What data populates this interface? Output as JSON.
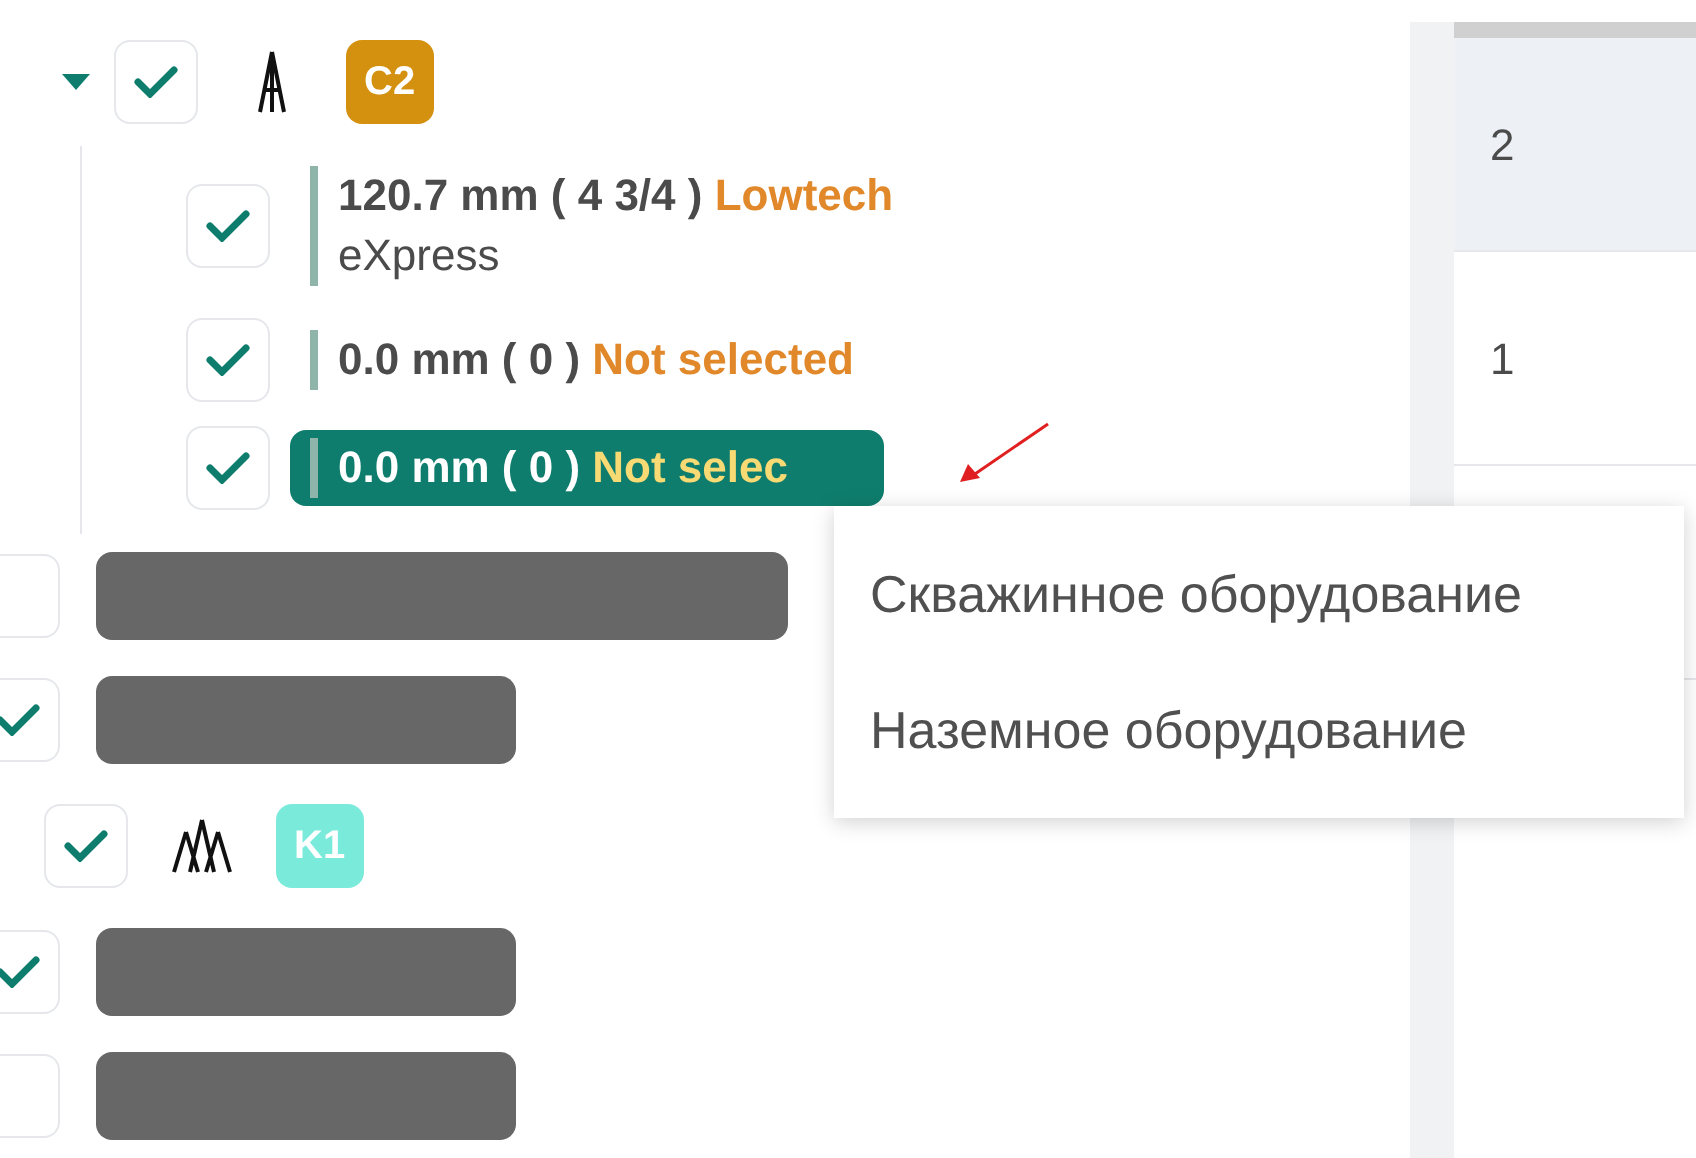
{
  "tree": [
    {
      "kind": "rig",
      "badge": "C2",
      "color": "#d4900f",
      "expanded": true,
      "checked": true,
      "children": [
        {
          "checked": true,
          "size": "120.7 mm ( 4 3/4 )",
          "status": "Lowtech",
          "subtitle": "eXpress",
          "selected": false
        },
        {
          "checked": true,
          "size": "0.0 mm ( 0 )",
          "status": "Not selected",
          "selected": false
        },
        {
          "checked": true,
          "size": "0.0 mm ( 0 )",
          "status": "Not selec",
          "selected": true
        }
      ]
    },
    {
      "kind": "hidden",
      "checked": false,
      "wide": true
    },
    {
      "kind": "hidden",
      "checked": true,
      "wide": false
    },
    {
      "kind": "rigs",
      "badge": "K1",
      "color": "#7aeadb",
      "expanded": false,
      "checked": true
    },
    {
      "kind": "hidden",
      "checked": true,
      "wide": false
    },
    {
      "kind": "hidden",
      "checked": false,
      "wide": false
    }
  ],
  "table": {
    "rows": [
      {
        "cell": "2",
        "selected": true
      },
      {
        "cell": "1",
        "selected": false
      },
      {
        "selected": false
      }
    ]
  },
  "context_menu": {
    "items": [
      "Скважинное оборудование",
      "Наземное оборудование"
    ]
  }
}
